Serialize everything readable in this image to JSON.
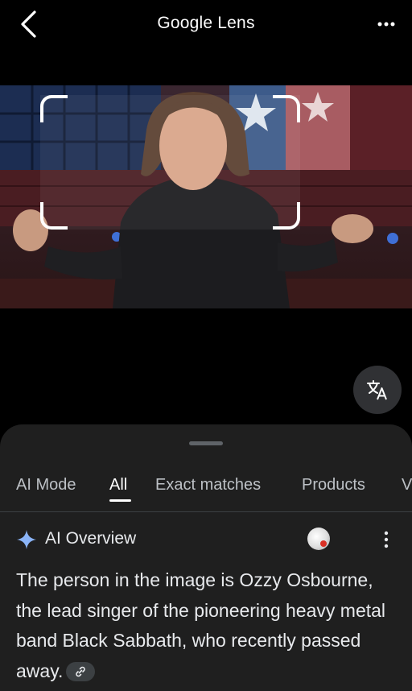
{
  "header": {
    "title_part1": "Google",
    "title_part2": " Lens",
    "back_icon": "chevron-left-icon",
    "more_icon": "more-horizontal-icon"
  },
  "image": {
    "description_icon": "photo",
    "selection": "crop-corners"
  },
  "translate_button": {
    "icon": "translate-icon"
  },
  "tabs": [
    {
      "label": "AI Mode",
      "active": false
    },
    {
      "label": "All",
      "active": true
    },
    {
      "label": "Exact matches",
      "active": false
    },
    {
      "label": "Products",
      "active": false
    },
    {
      "label": "V",
      "active": false
    }
  ],
  "ai_overview": {
    "title": "AI Overview",
    "text": "The person in the image is Ozzy Osbourne, the lead singer of the pioneering heavy metal band Black Sabbath, who recently passed away.",
    "sparkle_color": "#8ab4f8"
  },
  "colors": {
    "sheet_bg": "#1f1f1f",
    "accent": "#8ab4f8"
  }
}
